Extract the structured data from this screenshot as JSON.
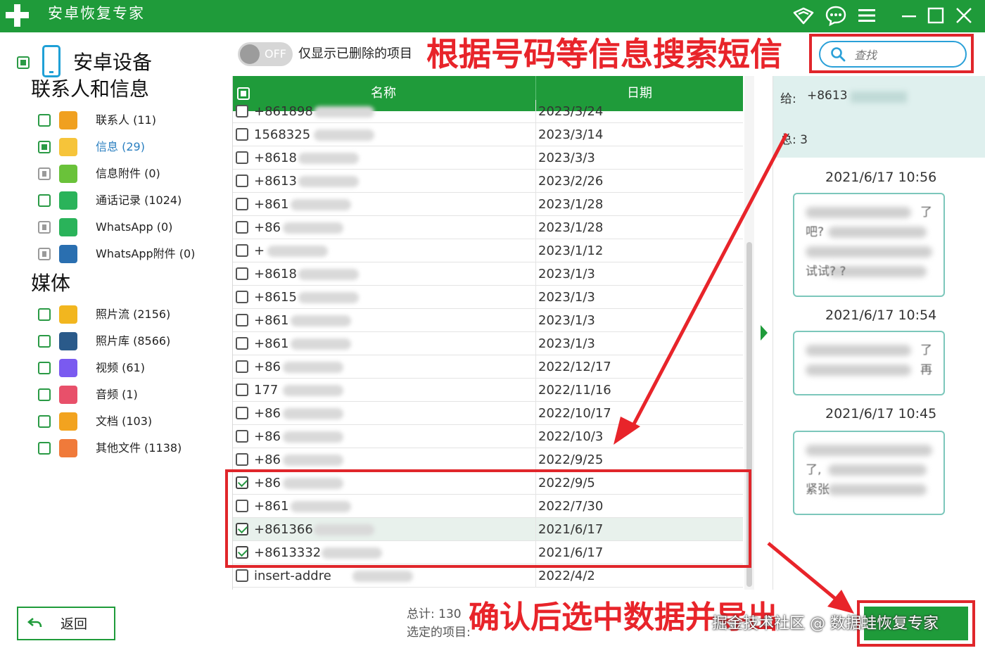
{
  "window": {
    "title": "安卓恢复专家",
    "colors": {
      "brand": "#1f9b3a",
      "annotation": "#e8242a",
      "link": "#2aa0d8"
    },
    "controls": [
      "wifi-icon",
      "feedback-icon",
      "menu-icon",
      "minimize-icon",
      "maximize-icon",
      "close-icon"
    ]
  },
  "sidebar": {
    "device_label": "安卓设备",
    "contacts_section": "联系人和信息",
    "contacts_items": [
      {
        "label": "联系人 (11)",
        "icon": "contacts-icon",
        "color": "#f0a020",
        "state": "unchecked"
      },
      {
        "label": "信息 (29)",
        "icon": "messages-icon",
        "color": "#f6c43a",
        "state": "partial"
      },
      {
        "label": "信息附件 (0)",
        "icon": "attachment-icon",
        "color": "#6ac23a",
        "state": "disabled"
      },
      {
        "label": "通话记录 (1024)",
        "icon": "phone-icon",
        "color": "#2ab35a",
        "state": "unchecked"
      },
      {
        "label": "WhatsApp (0)",
        "icon": "whatsapp-icon",
        "color": "#2ab35a",
        "state": "disabled"
      },
      {
        "label": "WhatsApp附件 (0)",
        "icon": "whatsapp-attachment-icon",
        "color": "#2a6fb0",
        "state": "disabled"
      }
    ],
    "media_section": "媒体",
    "media_items": [
      {
        "label": "照片流 (2156)",
        "icon": "photo-stream-icon",
        "color": "#f2b61f",
        "state": "unchecked"
      },
      {
        "label": "照片库 (8566)",
        "icon": "photo-library-icon",
        "color": "#2a5a8a",
        "state": "unchecked"
      },
      {
        "label": "视频 (61)",
        "icon": "video-icon",
        "color": "#7a5af0",
        "state": "unchecked"
      },
      {
        "label": "音频 (1)",
        "icon": "audio-icon",
        "color": "#e8506a",
        "state": "unchecked"
      },
      {
        "label": "文档 (103)",
        "icon": "document-icon",
        "color": "#f2a31f",
        "state": "unchecked"
      },
      {
        "label": "其他文件 (1138)",
        "icon": "other-files-icon",
        "color": "#f07a3a",
        "state": "unchecked"
      }
    ]
  },
  "toolbar": {
    "toggle_text": "OFF",
    "toggle_label": "仅显示已删除的项目",
    "annotation": "根据号码等信息搜索短信",
    "search_placeholder": "查找"
  },
  "table": {
    "columns": [
      "名称",
      "日期"
    ],
    "rows": [
      {
        "name": "+861898",
        "date": "2023/3/24",
        "checked": false
      },
      {
        "name": "1568325",
        "date": "2023/3/14",
        "checked": false
      },
      {
        "name": "+8618",
        "date": "2023/3/3",
        "checked": false
      },
      {
        "name": "+8613",
        "date": "2023/2/26",
        "checked": false
      },
      {
        "name": "+861",
        "date": "2023/1/28",
        "checked": false
      },
      {
        "name": "+86",
        "date": "2023/1/28",
        "checked": false
      },
      {
        "name": "+",
        "date": "2023/1/12",
        "checked": false
      },
      {
        "name": "+8618",
        "date": "2023/1/3",
        "checked": false
      },
      {
        "name": "+8615",
        "date": "2023/1/3",
        "checked": false
      },
      {
        "name": "+861",
        "date": "2023/1/3",
        "checked": false
      },
      {
        "name": "+861",
        "date": "2023/1/3",
        "checked": false
      },
      {
        "name": "+86",
        "date": "2022/12/17",
        "checked": false
      },
      {
        "name": "177",
        "date": "2022/11/16",
        "checked": false
      },
      {
        "name": "+86",
        "date": "2022/10/17",
        "checked": false
      },
      {
        "name": "+86",
        "date": "2022/10/3",
        "checked": false
      },
      {
        "name": "+86",
        "date": "2022/9/25",
        "checked": false
      },
      {
        "name": "+86",
        "date": "2022/9/5",
        "checked": true
      },
      {
        "name": "+861",
        "date": "2022/7/30",
        "checked": false
      },
      {
        "name": "+861366",
        "date": "2021/6/17",
        "checked": true,
        "selected": true
      },
      {
        "name": "+8613332",
        "date": "2021/6/17",
        "checked": true
      },
      {
        "name": "insert-addre",
        "date": "2022/4/2",
        "checked": false
      }
    ]
  },
  "detail": {
    "to_label": "给:",
    "to_value": "+8613",
    "total_label": "总: 3",
    "messages": [
      {
        "time": "2021/6/17 10:56",
        "lines": [
          "了",
          "吧?",
          "",
          "试试? ?"
        ]
      },
      {
        "time": "2021/6/17 10:54",
        "lines": [
          "了",
          "再"
        ]
      },
      {
        "time": "2021/6/17 10:45",
        "lines": [
          "",
          "了,",
          "紧张"
        ]
      }
    ]
  },
  "footer": {
    "back_label": "返回",
    "summary_total": "总计: 130",
    "summary_selected": "选定的项目:",
    "annotation": "确认后选中数据并导出",
    "recover_label": "恢复",
    "watermark": "掘金技术社区 @ 数据蛙恢复专家"
  }
}
